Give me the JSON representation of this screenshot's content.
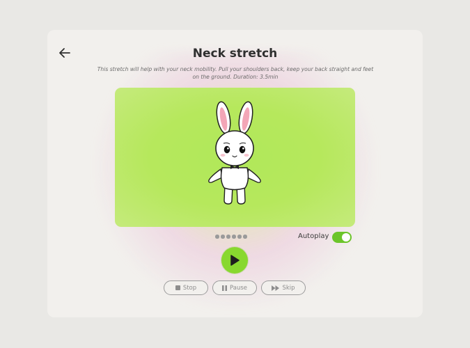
{
  "header": {
    "title": "Neck stretch",
    "description": "This stretch will help with your neck mobility. Pull your shoulders back, keep your back straight and feet on the ground. Duration: 3.5min",
    "back_icon": "arrow-left-icon"
  },
  "stage": {
    "background_color": "#b4e85c",
    "illustration": "bunny-mascot"
  },
  "pager": {
    "count": 6
  },
  "autoplay": {
    "label": "Autoplay",
    "enabled": true,
    "color": "#6cc52a"
  },
  "controls": {
    "play_icon": "play-icon",
    "play_color": "#88d82f",
    "stop_label": "Stop",
    "pause_label": "Pause",
    "skip_label": "Skip"
  }
}
